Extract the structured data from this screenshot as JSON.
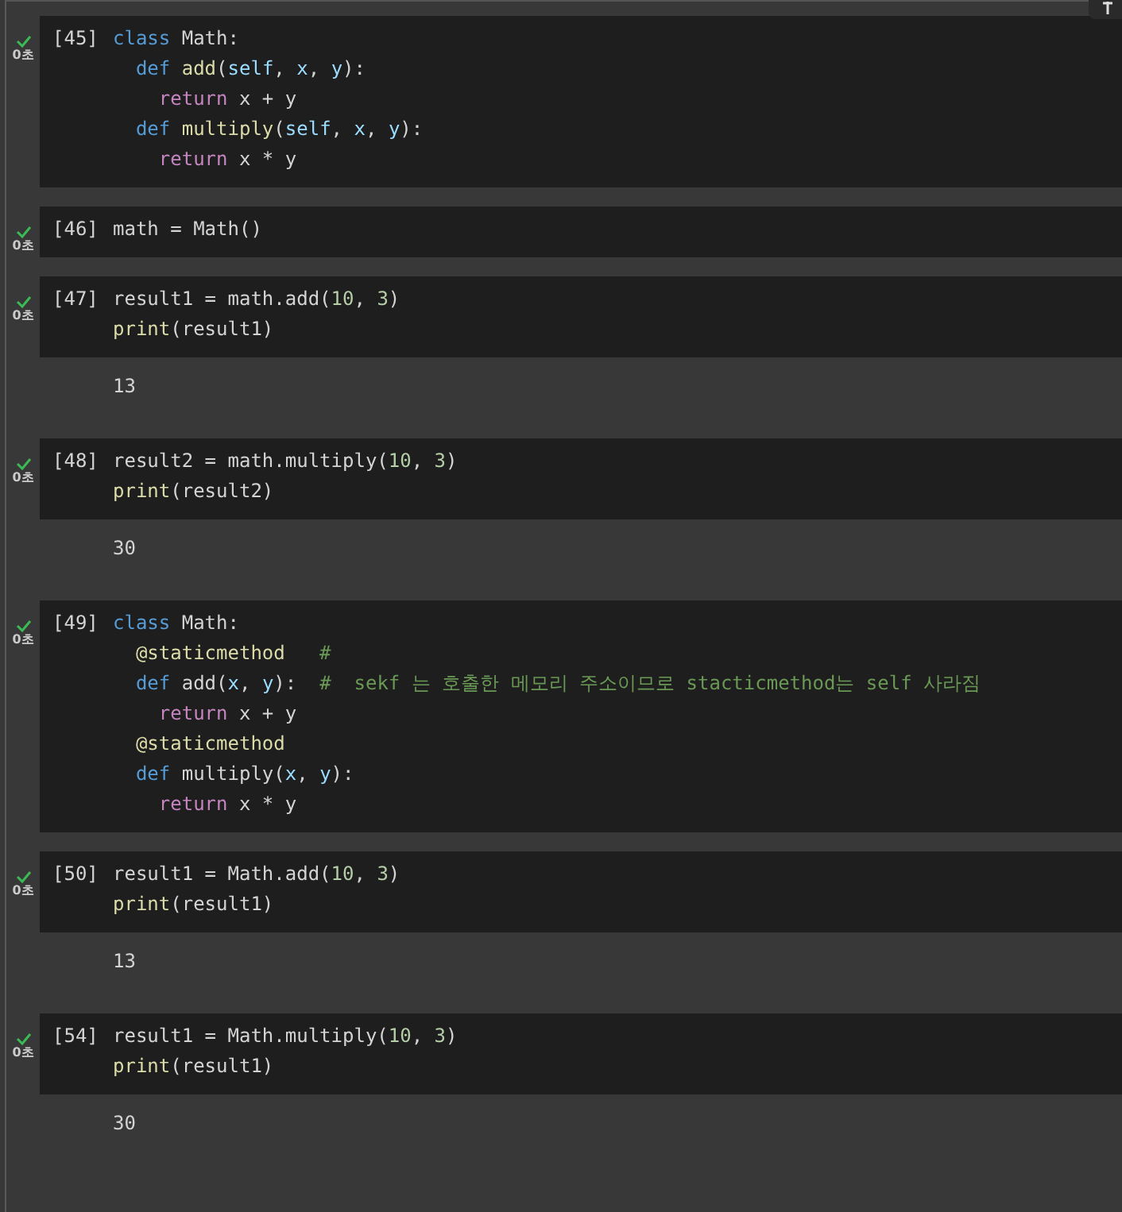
{
  "cells": [
    {
      "count": "[45]",
      "time": "0초",
      "lines": [
        [
          {
            "kind": "keyword",
            "t": "class"
          },
          {
            "kind": "plain",
            "t": " Math:"
          }
        ],
        [
          {
            "kind": "keyword",
            "t": "  def"
          },
          {
            "kind": "function",
            "t": " add"
          },
          {
            "kind": "plain",
            "t": "("
          },
          {
            "kind": "param",
            "t": "self"
          },
          {
            "kind": "plain",
            "t": ", "
          },
          {
            "kind": "param",
            "t": "x"
          },
          {
            "kind": "plain",
            "t": ", "
          },
          {
            "kind": "param",
            "t": "y"
          },
          {
            "kind": "plain",
            "t": "):"
          }
        ],
        [
          {
            "kind": "control",
            "t": "    return"
          },
          {
            "kind": "plain",
            "t": " x + y"
          }
        ],
        [
          {
            "kind": "keyword",
            "t": "  def"
          },
          {
            "kind": "function",
            "t": " multiply"
          },
          {
            "kind": "plain",
            "t": "("
          },
          {
            "kind": "param",
            "t": "self"
          },
          {
            "kind": "plain",
            "t": ", "
          },
          {
            "kind": "param",
            "t": "x"
          },
          {
            "kind": "plain",
            "t": ", "
          },
          {
            "kind": "param",
            "t": "y"
          },
          {
            "kind": "plain",
            "t": "):"
          }
        ],
        [
          {
            "kind": "control",
            "t": "    return"
          },
          {
            "kind": "plain",
            "t": " x * y"
          }
        ]
      ]
    },
    {
      "count": "[46]",
      "time": "0초",
      "lines": [
        [
          {
            "kind": "plain",
            "t": "math = Math()"
          }
        ]
      ]
    },
    {
      "count": "[47]",
      "time": "0초",
      "lines": [
        [
          {
            "kind": "plain",
            "t": "result1 = math.add("
          },
          {
            "kind": "number",
            "t": "10"
          },
          {
            "kind": "plain",
            "t": ", "
          },
          {
            "kind": "number",
            "t": "3"
          },
          {
            "kind": "plain",
            "t": ")"
          }
        ],
        [
          {
            "kind": "function",
            "t": "print"
          },
          {
            "kind": "plain",
            "t": "(result1)"
          }
        ]
      ],
      "output": "13"
    },
    {
      "count": "[48]",
      "time": "0초",
      "lines": [
        [
          {
            "kind": "plain",
            "t": "result2 = math.multiply("
          },
          {
            "kind": "number",
            "t": "10"
          },
          {
            "kind": "plain",
            "t": ", "
          },
          {
            "kind": "number",
            "t": "3"
          },
          {
            "kind": "plain",
            "t": ")"
          }
        ],
        [
          {
            "kind": "function",
            "t": "print"
          },
          {
            "kind": "plain",
            "t": "(result2)"
          }
        ]
      ],
      "output": "30"
    },
    {
      "count": "[49]",
      "time": "0초",
      "lines": [
        [
          {
            "kind": "keyword",
            "t": "class"
          },
          {
            "kind": "plain",
            "t": " Math:"
          }
        ],
        [
          {
            "kind": "decorator",
            "t": "  @staticmethod"
          },
          {
            "kind": "comment",
            "t": "   #"
          }
        ],
        [
          {
            "kind": "keyword",
            "t": "  def"
          },
          {
            "kind": "plain",
            "t": " add("
          },
          {
            "kind": "param",
            "t": "x"
          },
          {
            "kind": "plain",
            "t": ", "
          },
          {
            "kind": "param",
            "t": "y"
          },
          {
            "kind": "plain",
            "t": "):"
          },
          {
            "kind": "comment",
            "t": "  #  sekf 는 호출한 메모리 주소이므로 stacticmethod는 self 사라짐"
          }
        ],
        [
          {
            "kind": "control",
            "t": "    return"
          },
          {
            "kind": "plain",
            "t": " x + y"
          }
        ],
        [
          {
            "kind": "decorator",
            "t": "  @staticmethod"
          }
        ],
        [
          {
            "kind": "keyword",
            "t": "  def"
          },
          {
            "kind": "plain",
            "t": " multiply("
          },
          {
            "kind": "param",
            "t": "x"
          },
          {
            "kind": "plain",
            "t": ", "
          },
          {
            "kind": "param",
            "t": "y"
          },
          {
            "kind": "plain",
            "t": "):"
          }
        ],
        [
          {
            "kind": "control",
            "t": "    return"
          },
          {
            "kind": "plain",
            "t": " x * y"
          }
        ]
      ]
    },
    {
      "count": "[50]",
      "time": "0초",
      "lines": [
        [
          {
            "kind": "plain",
            "t": "result1 = Math.add("
          },
          {
            "kind": "number",
            "t": "10"
          },
          {
            "kind": "plain",
            "t": ", "
          },
          {
            "kind": "number",
            "t": "3"
          },
          {
            "kind": "plain",
            "t": ")"
          }
        ],
        [
          {
            "kind": "function",
            "t": "print"
          },
          {
            "kind": "plain",
            "t": "(result1)"
          }
        ]
      ],
      "output": "13"
    },
    {
      "count": "[54]",
      "time": "0초",
      "lines": [
        [
          {
            "kind": "plain",
            "t": "result1 = Math.multiply("
          },
          {
            "kind": "number",
            "t": "10"
          },
          {
            "kind": "plain",
            "t": ", "
          },
          {
            "kind": "number",
            "t": "3"
          },
          {
            "kind": "plain",
            "t": ")"
          }
        ],
        [
          {
            "kind": "function",
            "t": "print"
          },
          {
            "kind": "plain",
            "t": "(result1)"
          }
        ]
      ],
      "output": "30"
    }
  ]
}
